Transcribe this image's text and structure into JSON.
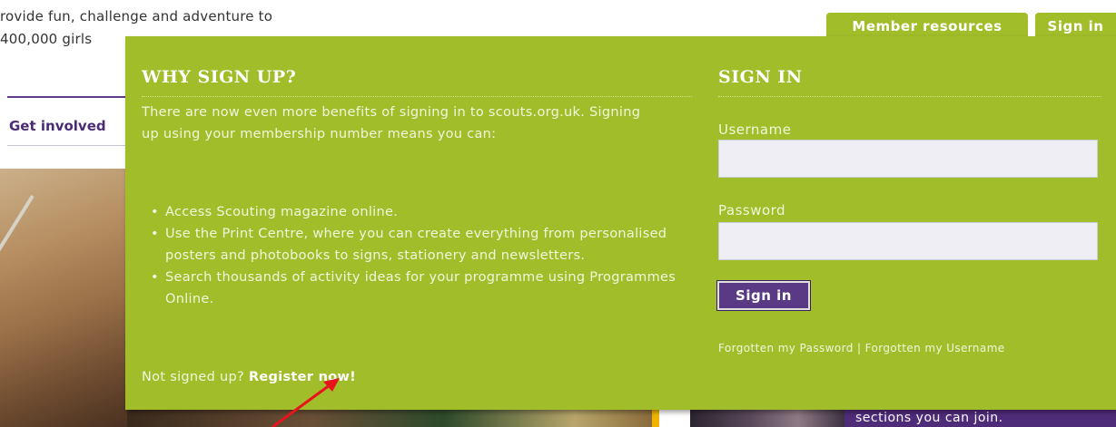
{
  "page": {
    "intro_line1": "rovide fun, challenge and adventure to",
    "intro_line2": "400,000 girls",
    "get_involved": "Get involved",
    "bottom_right_text": "sections you can join."
  },
  "tabs": {
    "member_resources": "Member resources",
    "sign_in": "Sign in"
  },
  "why_sign_up": {
    "title": "WHY SIGN UP?",
    "intro": "There are now even more benefits of signing in to scouts.org.uk. Signing up using your membership number means you can:",
    "benefits": [
      "Access Scouting magazine online.",
      "Use the Print Centre, where you can create everything from personalised posters and photobooks to signs, stationery and newsletters.",
      "Search thousands of activity ideas for your programme using Programmes Online."
    ],
    "not_signed_up": "Not signed up?",
    "register_link": "Register now!"
  },
  "sign_in": {
    "title": "SIGN IN",
    "username_label": "Username",
    "username_value": "",
    "password_label": "Password",
    "password_value": "",
    "button_label": "Sign in",
    "forgot_password": "Forgotten my Password",
    "separator": "|",
    "forgot_username": "Forgotten my Username"
  },
  "colors": {
    "panel_green": "#a1bd2a",
    "brand_purple": "#5b3a85",
    "annotation_arrow": "#e8141b"
  }
}
